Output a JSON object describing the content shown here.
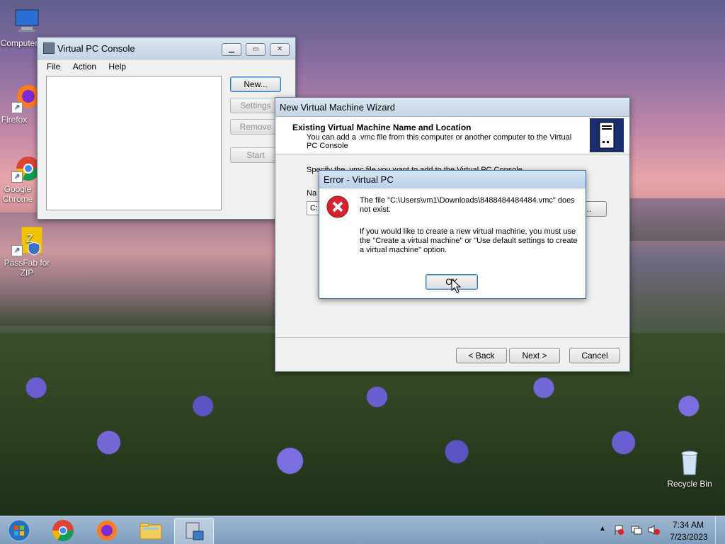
{
  "desktop": {
    "icons": [
      {
        "label": "Computer"
      },
      {
        "label": "Firefox"
      },
      {
        "label": "Google Chrome"
      },
      {
        "label": "PassFab for ZIP"
      },
      {
        "label": "Recycle Bin"
      }
    ]
  },
  "vpc_console": {
    "title": "Virtual PC Console",
    "menu": [
      "File",
      "Action",
      "Help"
    ],
    "buttons": {
      "new": "New...",
      "settings": "Settings",
      "remove": "Remove",
      "start": "Start"
    }
  },
  "wizard": {
    "title": "New Virtual Machine Wizard",
    "heading": "Existing Virtual Machine Name and Location",
    "subheading": "You can add a .vmc file from this computer or another computer to the Virtual PC Console",
    "instruction": "Specify the .vmc file you want to add to the Virtual PC Console",
    "name_label": "Na",
    "path_value": "C:",
    "browse_label": "e...",
    "buttons": {
      "back": "< Back",
      "next": "Next >",
      "cancel": "Cancel"
    }
  },
  "error": {
    "title": "Error - Virtual PC",
    "message1": "The file \"C:\\Users\\vm1\\Downloads\\8488484484484.vmc\" does not exist.",
    "message2": "If you would like to create a new virtual machine, you must use the \"Create a virtual machine\" or \"Use default settings to create a virtual machine\" option.",
    "ok": "OK"
  },
  "taskbar": {
    "time": "7:34 AM",
    "date": "7/23/2023",
    "items": [
      "start-orb-icon",
      "chrome-icon",
      "firefox-icon",
      "file-explorer-icon",
      "virtual-pc-icon"
    ]
  },
  "colors": {
    "accent": "#1a2e6e",
    "error": "#d9212b"
  }
}
